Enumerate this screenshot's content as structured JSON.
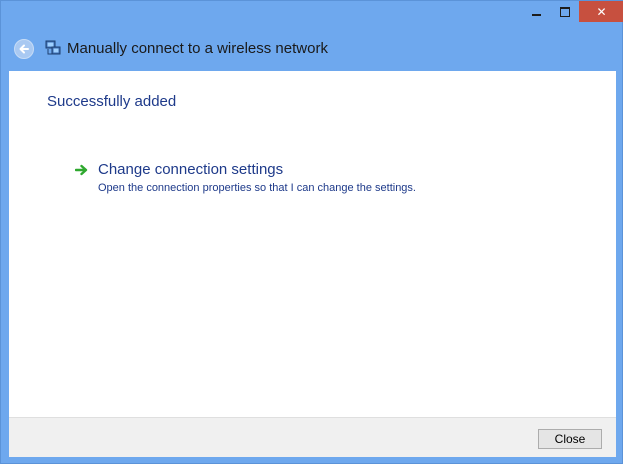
{
  "window": {
    "caption_buttons": {
      "minimize_icon": "minimize-icon",
      "maximize_icon": "maximize-icon",
      "close_icon": "close-icon"
    },
    "colors": {
      "frame": "#6ea8ee",
      "close_button": "#c7503f",
      "link_text": "#1e3a8a",
      "arrow": "#2fa82f"
    }
  },
  "header": {
    "back_icon": "back-arrow-icon",
    "network_icon": "network-connection-icon",
    "title": "Manually connect to a wireless network"
  },
  "main": {
    "status_title": "Successfully added",
    "action": {
      "icon": "green-arrow-icon",
      "title": "Change connection settings",
      "description": "Open the connection properties so that I can change the settings."
    }
  },
  "footer": {
    "close_label": "Close"
  }
}
